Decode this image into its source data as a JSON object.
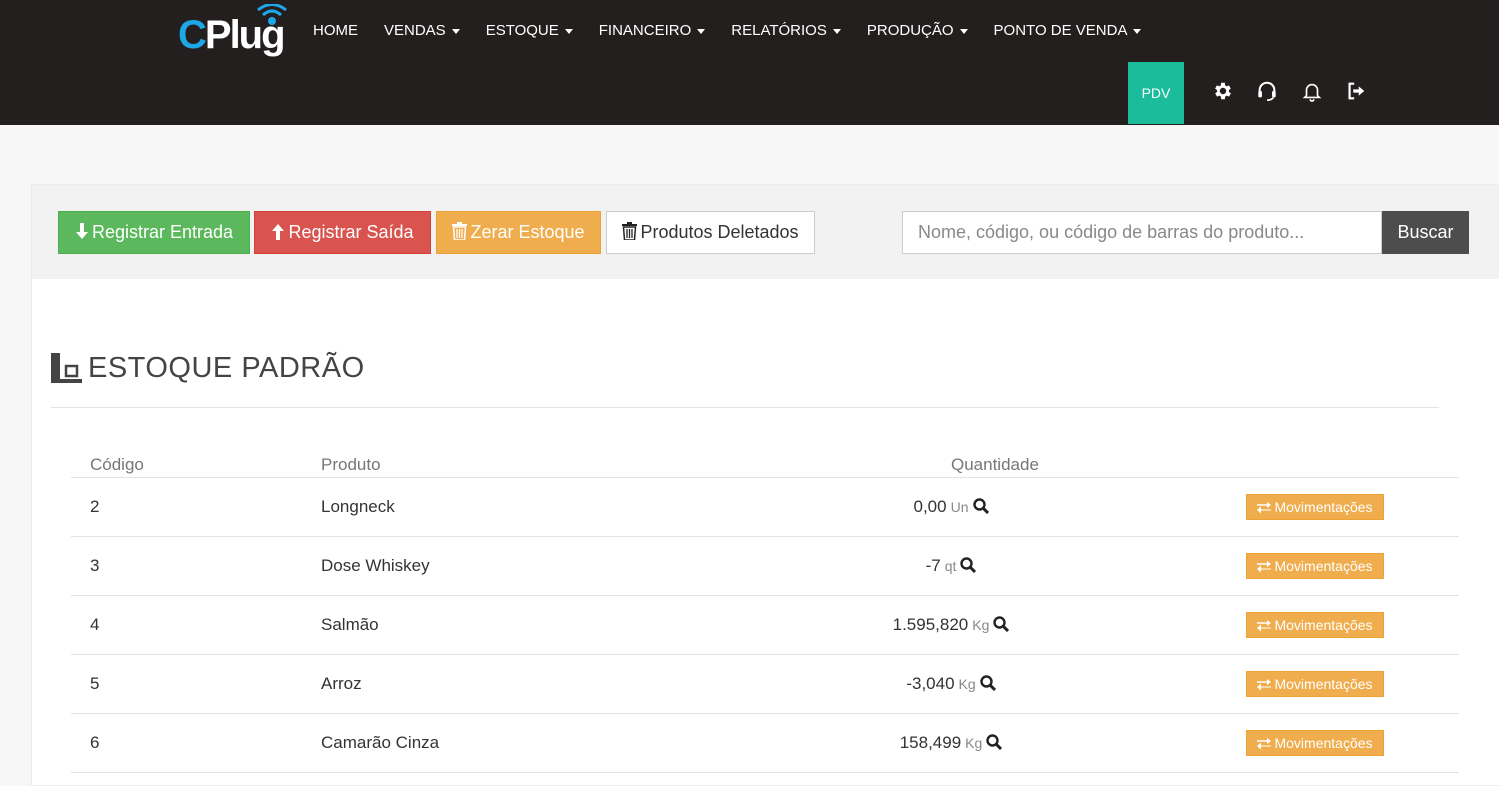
{
  "nav": {
    "logo_text": "CPlug",
    "menu": [
      {
        "label": "HOME",
        "dropdown": false
      },
      {
        "label": "VENDAS",
        "dropdown": true
      },
      {
        "label": "ESTOQUE",
        "dropdown": true
      },
      {
        "label": "FINANCEIRO",
        "dropdown": true
      },
      {
        "label": "RELATÓRIOS",
        "dropdown": true
      },
      {
        "label": "PRODUÇÃO",
        "dropdown": true
      },
      {
        "label": "PONTO DE VENDA",
        "dropdown": true
      }
    ],
    "pdv_label": "PDV",
    "icons": [
      "gear-icon",
      "headset-icon",
      "bell-icon",
      "logout-icon"
    ]
  },
  "toolbar": {
    "entrada_label": "Registrar Entrada",
    "saida_label": "Registrar Saída",
    "zerar_label": "Zerar Estoque",
    "deletados_label": "Produtos Deletados",
    "search_placeholder": "Nome, código, ou código de barras do produto...",
    "search_value": "",
    "buscar_label": "Buscar"
  },
  "page": {
    "title": "ESTOQUE PADRÃO"
  },
  "table": {
    "headers": {
      "code": "Código",
      "product": "Produto",
      "quantity": "Quantidade"
    },
    "action_label": "Movimentações",
    "rows": [
      {
        "code": "2",
        "product": "Longneck",
        "qty": "0,00",
        "unit": "Un"
      },
      {
        "code": "3",
        "product": "Dose Whiskey",
        "qty": "-7",
        "unit": "qt"
      },
      {
        "code": "4",
        "product": "Salmão",
        "qty": "1.595,820",
        "unit": "Kg"
      },
      {
        "code": "5",
        "product": "Arroz",
        "qty": "-3,040",
        "unit": "Kg"
      },
      {
        "code": "6",
        "product": "Camarão Cinza",
        "qty": "158,499",
        "unit": "Kg"
      }
    ]
  },
  "colors": {
    "navbar": "#231f1e",
    "pdv": "#1abc9c",
    "success": "#5cb85c",
    "danger": "#d9534f",
    "warning": "#f0ad4e",
    "logo_accent": "#1ea7e6"
  }
}
